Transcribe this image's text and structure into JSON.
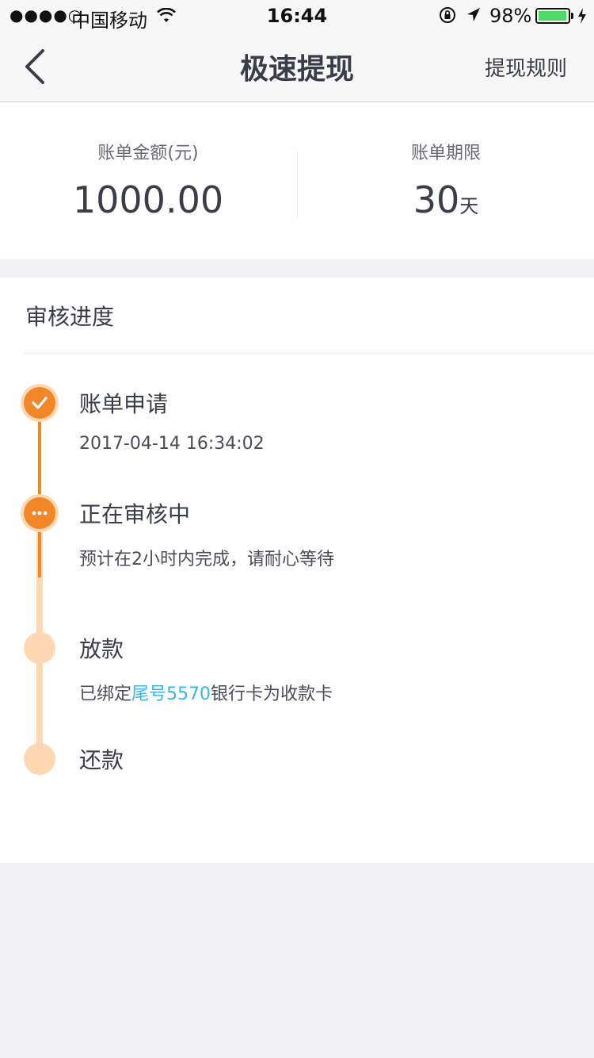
{
  "status_bar": {
    "signal": "●●●●○",
    "carrier": "中国移动",
    "time": "16:44",
    "battery_pct": "98%",
    "battery_level": 0.98
  },
  "nav": {
    "title": "极速提现",
    "right_link": "提现规则"
  },
  "summary": {
    "amount_label": "账单金额(元)",
    "amount_value": "1000.00",
    "term_label": "账单期限",
    "term_value": "30",
    "term_unit": "天"
  },
  "progress": {
    "title": "审核进度",
    "steps": [
      {
        "title": "账单申请",
        "desc": "2017-04-14 16:34:02",
        "state": "done"
      },
      {
        "title": "正在审核中",
        "desc": "预计在2小时内完成，请耐心等待",
        "state": "current"
      },
      {
        "title": "放款",
        "desc_prefix": "已绑定",
        "desc_highlight": "尾号5570",
        "desc_suffix": "银行卡为收款卡",
        "state": "pending"
      },
      {
        "title": "还款",
        "state": "pending"
      }
    ]
  },
  "colors": {
    "accent": "#f2872a",
    "accent_light": "#ffd7b2",
    "link": "#37b7e8"
  }
}
